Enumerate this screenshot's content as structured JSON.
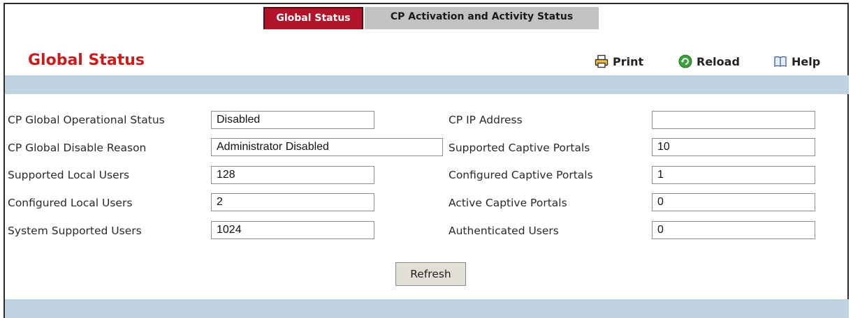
{
  "tabs": [
    {
      "label": "Global Status"
    },
    {
      "label": "CP Activation and Activity Status"
    }
  ],
  "page_title": "Global Status",
  "toolbar": {
    "print": "Print",
    "reload": "Reload",
    "help": "Help"
  },
  "left_fields": [
    {
      "label": "CP Global Operational Status",
      "value": "Disabled"
    },
    {
      "label": "CP Global Disable Reason",
      "value": "Administrator Disabled"
    },
    {
      "label": "Supported Local Users",
      "value": "128"
    },
    {
      "label": "Configured Local Users",
      "value": "2"
    },
    {
      "label": "System Supported Users",
      "value": "1024"
    }
  ],
  "right_fields": [
    {
      "label": "CP IP Address",
      "value": ""
    },
    {
      "label": "Supported Captive Portals",
      "value": "10"
    },
    {
      "label": "Configured Captive Portals",
      "value": "1"
    },
    {
      "label": "Active Captive Portals",
      "value": "0"
    },
    {
      "label": "Authenticated Users",
      "value": "0"
    }
  ],
  "refresh_button": "Refresh",
  "colors": {
    "active_tab": "#b0132a",
    "inactive_tab": "#c2c2c2",
    "title": "#cc1b1b",
    "band": "#c0d3e1"
  }
}
